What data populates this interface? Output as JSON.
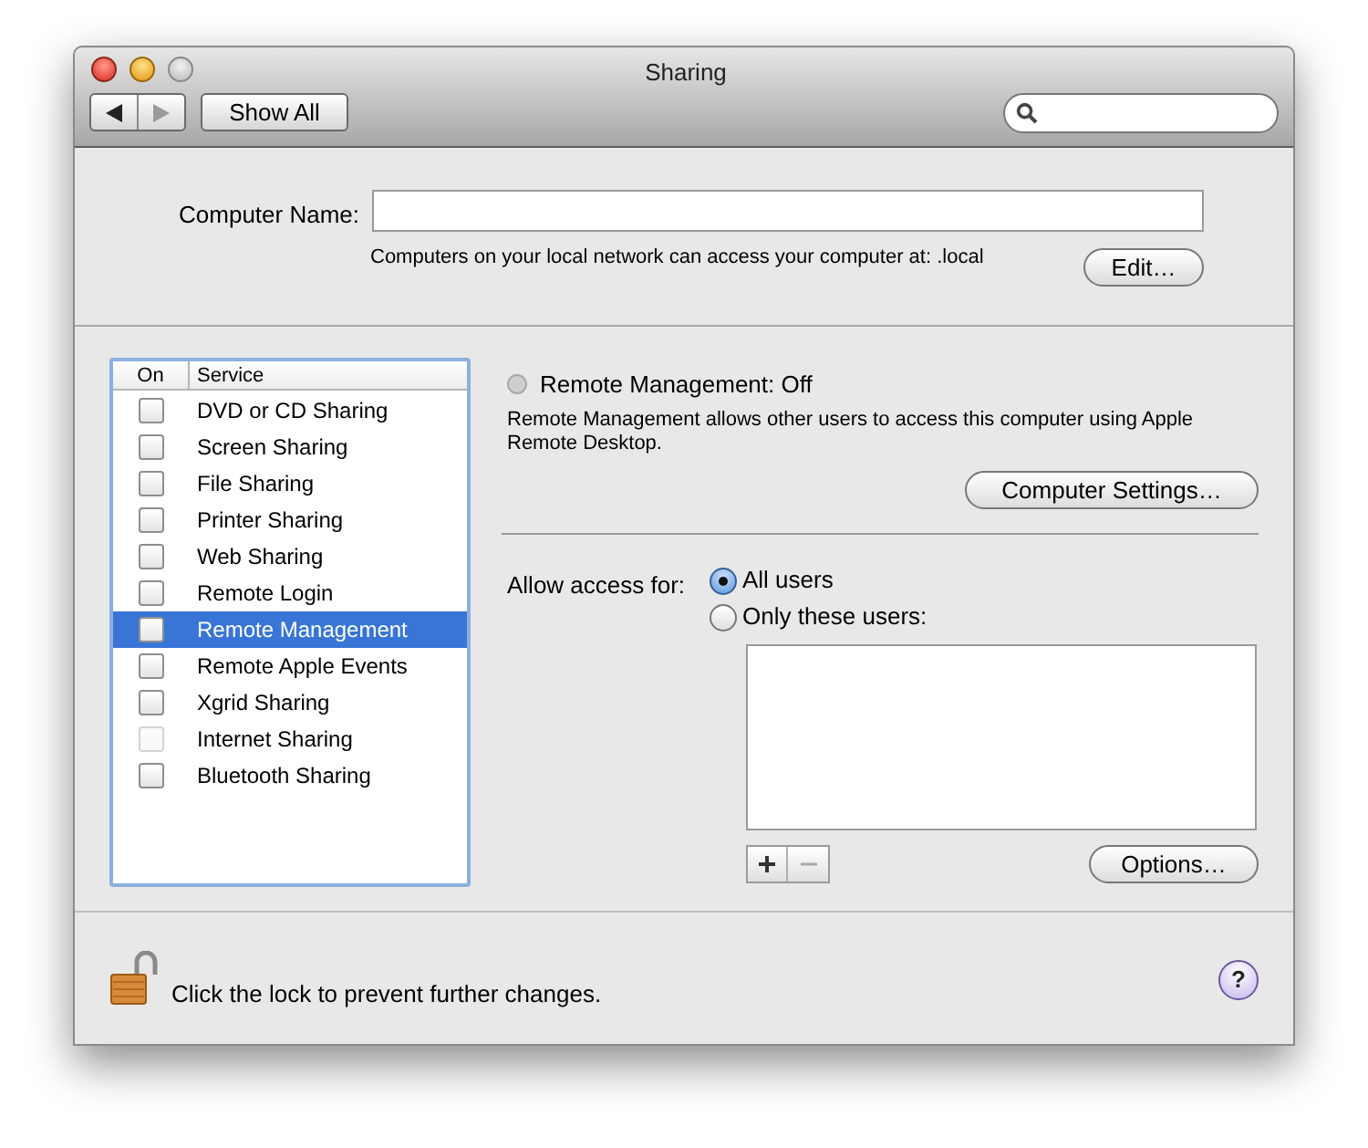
{
  "window": {
    "title": "Sharing"
  },
  "toolbar": {
    "show_all": "Show All"
  },
  "computer_name": {
    "label": "Computer Name:",
    "note": "Computers on your local network can access your computer at: .local",
    "edit_button": "Edit…"
  },
  "services": {
    "columns": [
      "On",
      "Service"
    ],
    "rows": [
      {
        "name": "DVD or CD Sharing",
        "checked": false,
        "disabled": false,
        "selected": false
      },
      {
        "name": "Screen Sharing",
        "checked": false,
        "disabled": false,
        "selected": false
      },
      {
        "name": "File Sharing",
        "checked": false,
        "disabled": false,
        "selected": false
      },
      {
        "name": "Printer Sharing",
        "checked": false,
        "disabled": false,
        "selected": false
      },
      {
        "name": "Web Sharing",
        "checked": false,
        "disabled": false,
        "selected": false
      },
      {
        "name": "Remote Login",
        "checked": false,
        "disabled": false,
        "selected": false
      },
      {
        "name": "Remote Management",
        "checked": false,
        "disabled": false,
        "selected": true
      },
      {
        "name": "Remote Apple Events",
        "checked": false,
        "disabled": false,
        "selected": false
      },
      {
        "name": "Xgrid Sharing",
        "checked": false,
        "disabled": false,
        "selected": false
      },
      {
        "name": "Internet Sharing",
        "checked": false,
        "disabled": true,
        "selected": false
      },
      {
        "name": "Bluetooth Sharing",
        "checked": false,
        "disabled": false,
        "selected": false
      }
    ]
  },
  "detail": {
    "status": {
      "text": "Remote Management: Off",
      "on": false
    },
    "description": "Remote Management allows other users to access this computer using Apple Remote Desktop.",
    "settings_button": "Computer Settings…",
    "access_label": "Allow access for:",
    "access_options": [
      {
        "label": "All users",
        "selected": true
      },
      {
        "label": "Only these users:",
        "selected": false
      }
    ],
    "options_button": "Options…"
  },
  "footer": {
    "lock_text": "Click the lock to prevent further changes.",
    "help": "?"
  }
}
